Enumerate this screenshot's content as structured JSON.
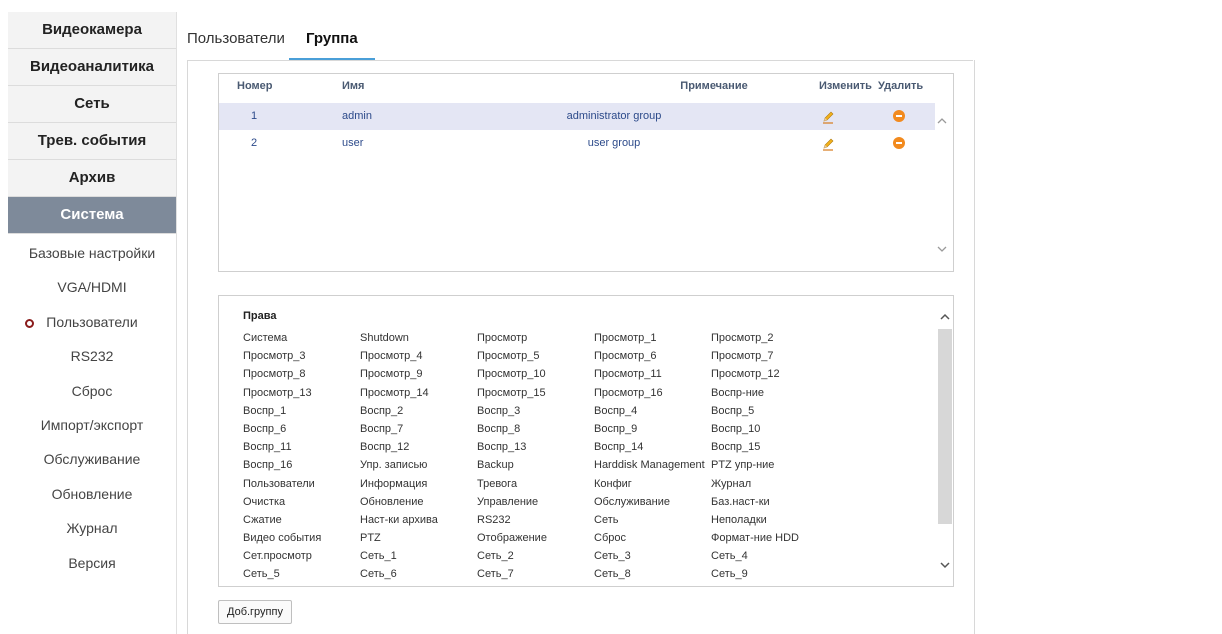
{
  "sidebar": {
    "main_items": [
      {
        "label": "Видеокамера"
      },
      {
        "label": "Видеоаналитика"
      },
      {
        "label": "Сеть"
      },
      {
        "label": "Трев. события"
      },
      {
        "label": "Архив"
      },
      {
        "label": "Система"
      }
    ],
    "active_main": "Система",
    "sub_items": [
      {
        "label": "Базовые настройки"
      },
      {
        "label": "VGA/HDMI"
      },
      {
        "label": "Пользователи"
      },
      {
        "label": "RS232"
      },
      {
        "label": "Сброс"
      },
      {
        "label": "Импорт/экспорт"
      },
      {
        "label": "Обслуживание"
      },
      {
        "label": "Обновление"
      },
      {
        "label": "Журнал"
      },
      {
        "label": "Версия"
      }
    ],
    "active_sub": "Пользователи"
  },
  "tabs": [
    {
      "label": "Пользователи"
    },
    {
      "label": "Группа"
    }
  ],
  "active_tab": "Группа",
  "group_table": {
    "headers": {
      "num": "Номер",
      "name": "Имя",
      "note": "Примечание",
      "edit": "Изменить",
      "delete": "Удалить"
    },
    "rows": [
      {
        "num": "1",
        "name": "admin",
        "note": "administrator group",
        "edit_icon": "pencil-icon",
        "delete_icon": "minus-circle-icon",
        "selected": true
      },
      {
        "num": "2",
        "name": "user",
        "note": "user group",
        "edit_icon": "pencil-icon",
        "delete_icon": "minus-circle-icon",
        "selected": false
      }
    ]
  },
  "rights": {
    "title": "Права",
    "rows": [
      [
        "Система",
        "Shutdown",
        "Просмотр",
        "Просмотр_1",
        "Просмотр_2"
      ],
      [
        "Просмотр_3",
        "Просмотр_4",
        "Просмотр_5",
        "Просмотр_6",
        "Просмотр_7"
      ],
      [
        "Просмотр_8",
        "Просмотр_9",
        "Просмотр_10",
        "Просмотр_11",
        "Просмотр_12"
      ],
      [
        "Просмотр_13",
        "Просмотр_14",
        "Просмотр_15",
        "Просмотр_16",
        "Воспр-ние"
      ],
      [
        "Воспр_1",
        "Воспр_2",
        "Воспр_3",
        "Воспр_4",
        "Воспр_5"
      ],
      [
        "Воспр_6",
        "Воспр_7",
        "Воспр_8",
        "Воспр_9",
        "Воспр_10"
      ],
      [
        "Воспр_11",
        "Воспр_12",
        "Воспр_13",
        "Воспр_14",
        "Воспр_15"
      ],
      [
        "Воспр_16",
        "Упр. записью",
        "Backup",
        "Harddisk Management",
        "PTZ упр-ние"
      ],
      [
        "Пользователи",
        "Информация",
        "Тревога",
        "Конфиг",
        "Журнал"
      ],
      [
        "Очистка",
        "Обновление",
        "Управление",
        "Обслуживание",
        "Баз.наст-ки"
      ],
      [
        "Сжатие",
        "Наст-ки архива",
        "RS232",
        "Сеть",
        "Неполадки"
      ],
      [
        "Видео события",
        "PTZ",
        "Отображение",
        "Сброс",
        "Формат-ние HDD"
      ],
      [
        "Сет.просмотр",
        "Сеть_1",
        "Сеть_2",
        "Сеть_3",
        "Сеть_4"
      ],
      [
        "Сеть_5",
        "Сеть_6",
        "Сеть_7",
        "Сеть_8",
        "Сеть_9"
      ]
    ]
  },
  "add_group_button": "Доб.группу",
  "colors": {
    "active_menu_bg": "#7e8a9a",
    "tab_underline": "#4a9fd8",
    "selected_row_bg": "#e4e6f4",
    "delete_icon": "#f28a1e",
    "active_dot": "#8a1c1c"
  }
}
